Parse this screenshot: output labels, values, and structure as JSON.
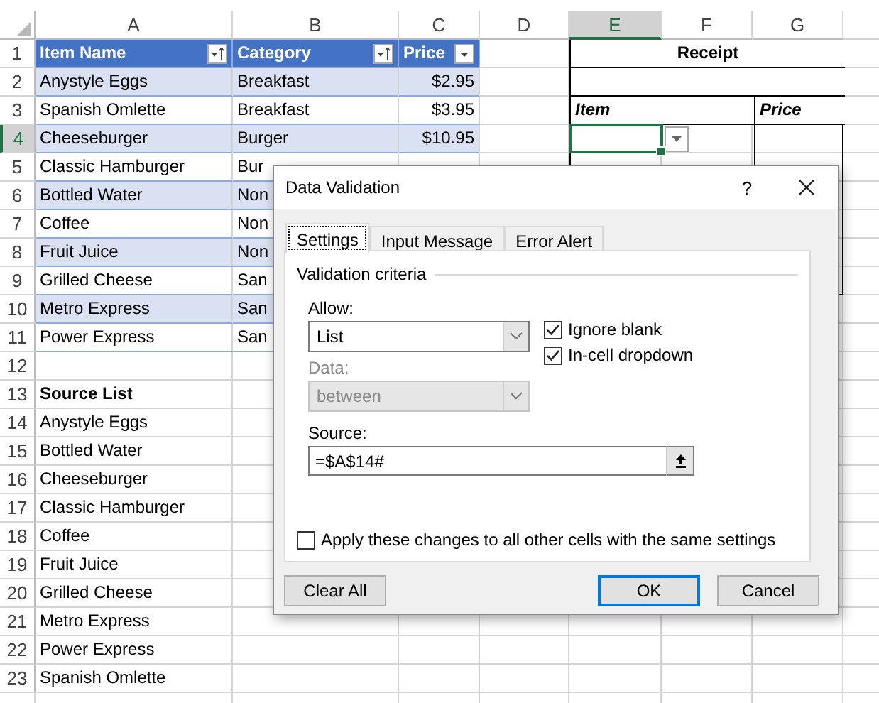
{
  "sheet": {
    "column_headers": [
      {
        "label": "A",
        "selected": false
      },
      {
        "label": "B",
        "selected": false
      },
      {
        "label": "C",
        "selected": false
      },
      {
        "label": "D",
        "selected": false
      },
      {
        "label": "E",
        "selected": true
      },
      {
        "label": "F",
        "selected": false
      },
      {
        "label": "G",
        "selected": false
      }
    ],
    "row_headers": [
      {
        "label": "1",
        "selected": false
      },
      {
        "label": "2",
        "selected": false
      },
      {
        "label": "3",
        "selected": false
      },
      {
        "label": "4",
        "selected": true
      },
      {
        "label": "5",
        "selected": false
      },
      {
        "label": "6",
        "selected": false
      },
      {
        "label": "7",
        "selected": false
      },
      {
        "label": "8",
        "selected": false
      },
      {
        "label": "9",
        "selected": false
      },
      {
        "label": "10",
        "selected": false
      },
      {
        "label": "11",
        "selected": false
      },
      {
        "label": "12",
        "selected": false
      },
      {
        "label": "13",
        "selected": false
      },
      {
        "label": "14",
        "selected": false
      },
      {
        "label": "15",
        "selected": false
      },
      {
        "label": "16",
        "selected": false
      },
      {
        "label": "17",
        "selected": false
      },
      {
        "label": "18",
        "selected": false
      },
      {
        "label": "19",
        "selected": false
      },
      {
        "label": "20",
        "selected": false
      },
      {
        "label": "21",
        "selected": false
      },
      {
        "label": "22",
        "selected": false
      },
      {
        "label": "23",
        "selected": false
      }
    ]
  },
  "table": {
    "columns": [
      {
        "label": "Item Name",
        "kind": "sorted"
      },
      {
        "label": "Category",
        "kind": "sorted"
      },
      {
        "label": "Price",
        "kind": "dropdown"
      }
    ],
    "rows": [
      [
        "Anystyle Eggs",
        "Breakfast",
        "$2.95"
      ],
      [
        "Spanish Omlette",
        "Breakfast",
        "$3.95"
      ],
      [
        "Cheeseburger",
        "Burger",
        "$10.95"
      ],
      [
        "Classic Hamburger",
        "Bur"
      ],
      [
        "Bottled Water",
        "Non"
      ],
      [
        "Coffee",
        "Non"
      ],
      [
        "Fruit Juice",
        "Non"
      ],
      [
        "Grilled Cheese",
        "San"
      ],
      [
        "Metro Express",
        "San"
      ],
      [
        "Power Express",
        "San"
      ]
    ]
  },
  "source_list": {
    "title": "Source List",
    "items": [
      "Anystyle Eggs",
      "Bottled Water",
      "Cheeseburger",
      "Classic Hamburger",
      "Coffee",
      "Fruit Juice",
      "Grilled Cheese",
      "Metro Express",
      "Power Express",
      "Spanish Omlette"
    ]
  },
  "receipt": {
    "title": "Receipt",
    "item_label": "Item",
    "price_label": "Price",
    "dropdown": true
  },
  "dialog": {
    "title": "Data Validation",
    "help": "?",
    "tabs": [
      {
        "label": "Settings",
        "selected": true
      },
      {
        "label": "Input Message",
        "selected": false
      },
      {
        "label": "Error Alert",
        "selected": false
      }
    ],
    "group_title": "Validation criteria",
    "allow": {
      "label": "Allow:",
      "value": "List",
      "disabled": false
    },
    "data": {
      "label": "Data:",
      "value": "between",
      "disabled": true
    },
    "checkboxes": [
      {
        "label": "Ignore blank",
        "checked": true
      },
      {
        "label": "In-cell dropdown",
        "checked": true
      }
    ],
    "source": {
      "label": "Source:",
      "value": "=$A$14#"
    },
    "apply_all": {
      "label": "Apply these changes to all other cells with the same settings",
      "checked": false
    },
    "buttons": [
      {
        "label": "Clear All",
        "default": false
      },
      {
        "label": "OK",
        "default": true
      },
      {
        "label": "Cancel",
        "default": false
      }
    ]
  }
}
